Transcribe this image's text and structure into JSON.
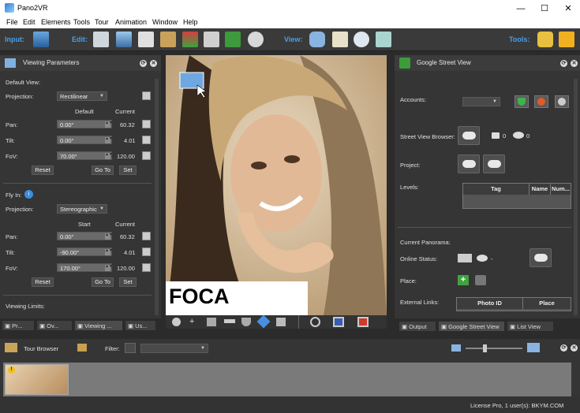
{
  "window": {
    "title": "Pano2VR",
    "minimize": "—",
    "maximize": "☐",
    "close": "✕"
  },
  "menu": [
    "File",
    "Edit",
    "Elements",
    "Tools",
    "Tour",
    "Animation",
    "Window",
    "Help"
  ],
  "toolbar": {
    "input_label": "Input:",
    "edit_label": "Edit:",
    "view_label": "View:",
    "tools_label": "Tools:"
  },
  "viewing_parameters": {
    "title": "Viewing Parameters",
    "default_view_label": "Default View:",
    "projection_label": "Projection:",
    "projection_value": "Rectilinear",
    "col_default": "Default",
    "col_current": "Current",
    "rows": [
      {
        "label": "Pan:",
        "default": "0.00°",
        "current": "60.32"
      },
      {
        "label": "Tilt:",
        "default": "0.00°",
        "current": "4.01"
      },
      {
        "label": "FoV:",
        "default": "70.00°",
        "current": "120.00"
      }
    ],
    "reset": "Reset",
    "goto": "Go To",
    "set": "Set",
    "fly_in_label": "Fly In:",
    "fly_projection_value": "Stereographic",
    "col_start": "Start",
    "fly_rows": [
      {
        "label": "Pan:",
        "start": "0.00°",
        "current": "60.32"
      },
      {
        "label": "Tilt:",
        "start": "-90.00°",
        "current": "4.01"
      },
      {
        "label": "FoV:",
        "start": "170.00°",
        "current": "120.00"
      }
    ],
    "viewing_limits_label": "Viewing Limits:"
  },
  "left_tabs": [
    "Pr...",
    "Ov...",
    "Viewing ...",
    "Us..."
  ],
  "viewer": {
    "overlay_text": "FOCA"
  },
  "street_view": {
    "title": "Google Street View",
    "accounts_label": "Accounts:",
    "browser_label": "Street View Browser:",
    "photo_count": "0",
    "view_count": "0",
    "project_label": "Project:",
    "levels_label": "Levels:",
    "levels_cols": [
      "Tag",
      "Name",
      "Num..."
    ],
    "current_panorama_label": "Current Panorama:",
    "online_status_label": "Online Status:",
    "online_status_value": "-",
    "place_label": "Place:",
    "external_links_label": "External Links:",
    "links_cols": [
      "Photo ID",
      "Place"
    ]
  },
  "right_tabs": [
    "Output",
    "Google Street View",
    "List View"
  ],
  "tour_browser": {
    "title": "Tour Browser",
    "filter_label": "Filter:"
  },
  "status": {
    "license": "License Pro, 1 user(s): BKYM.COM"
  },
  "colors": {
    "accent_blue": "#4a9ee8",
    "panel_bg": "#353535",
    "dark_bg": "#2b2b2b"
  }
}
